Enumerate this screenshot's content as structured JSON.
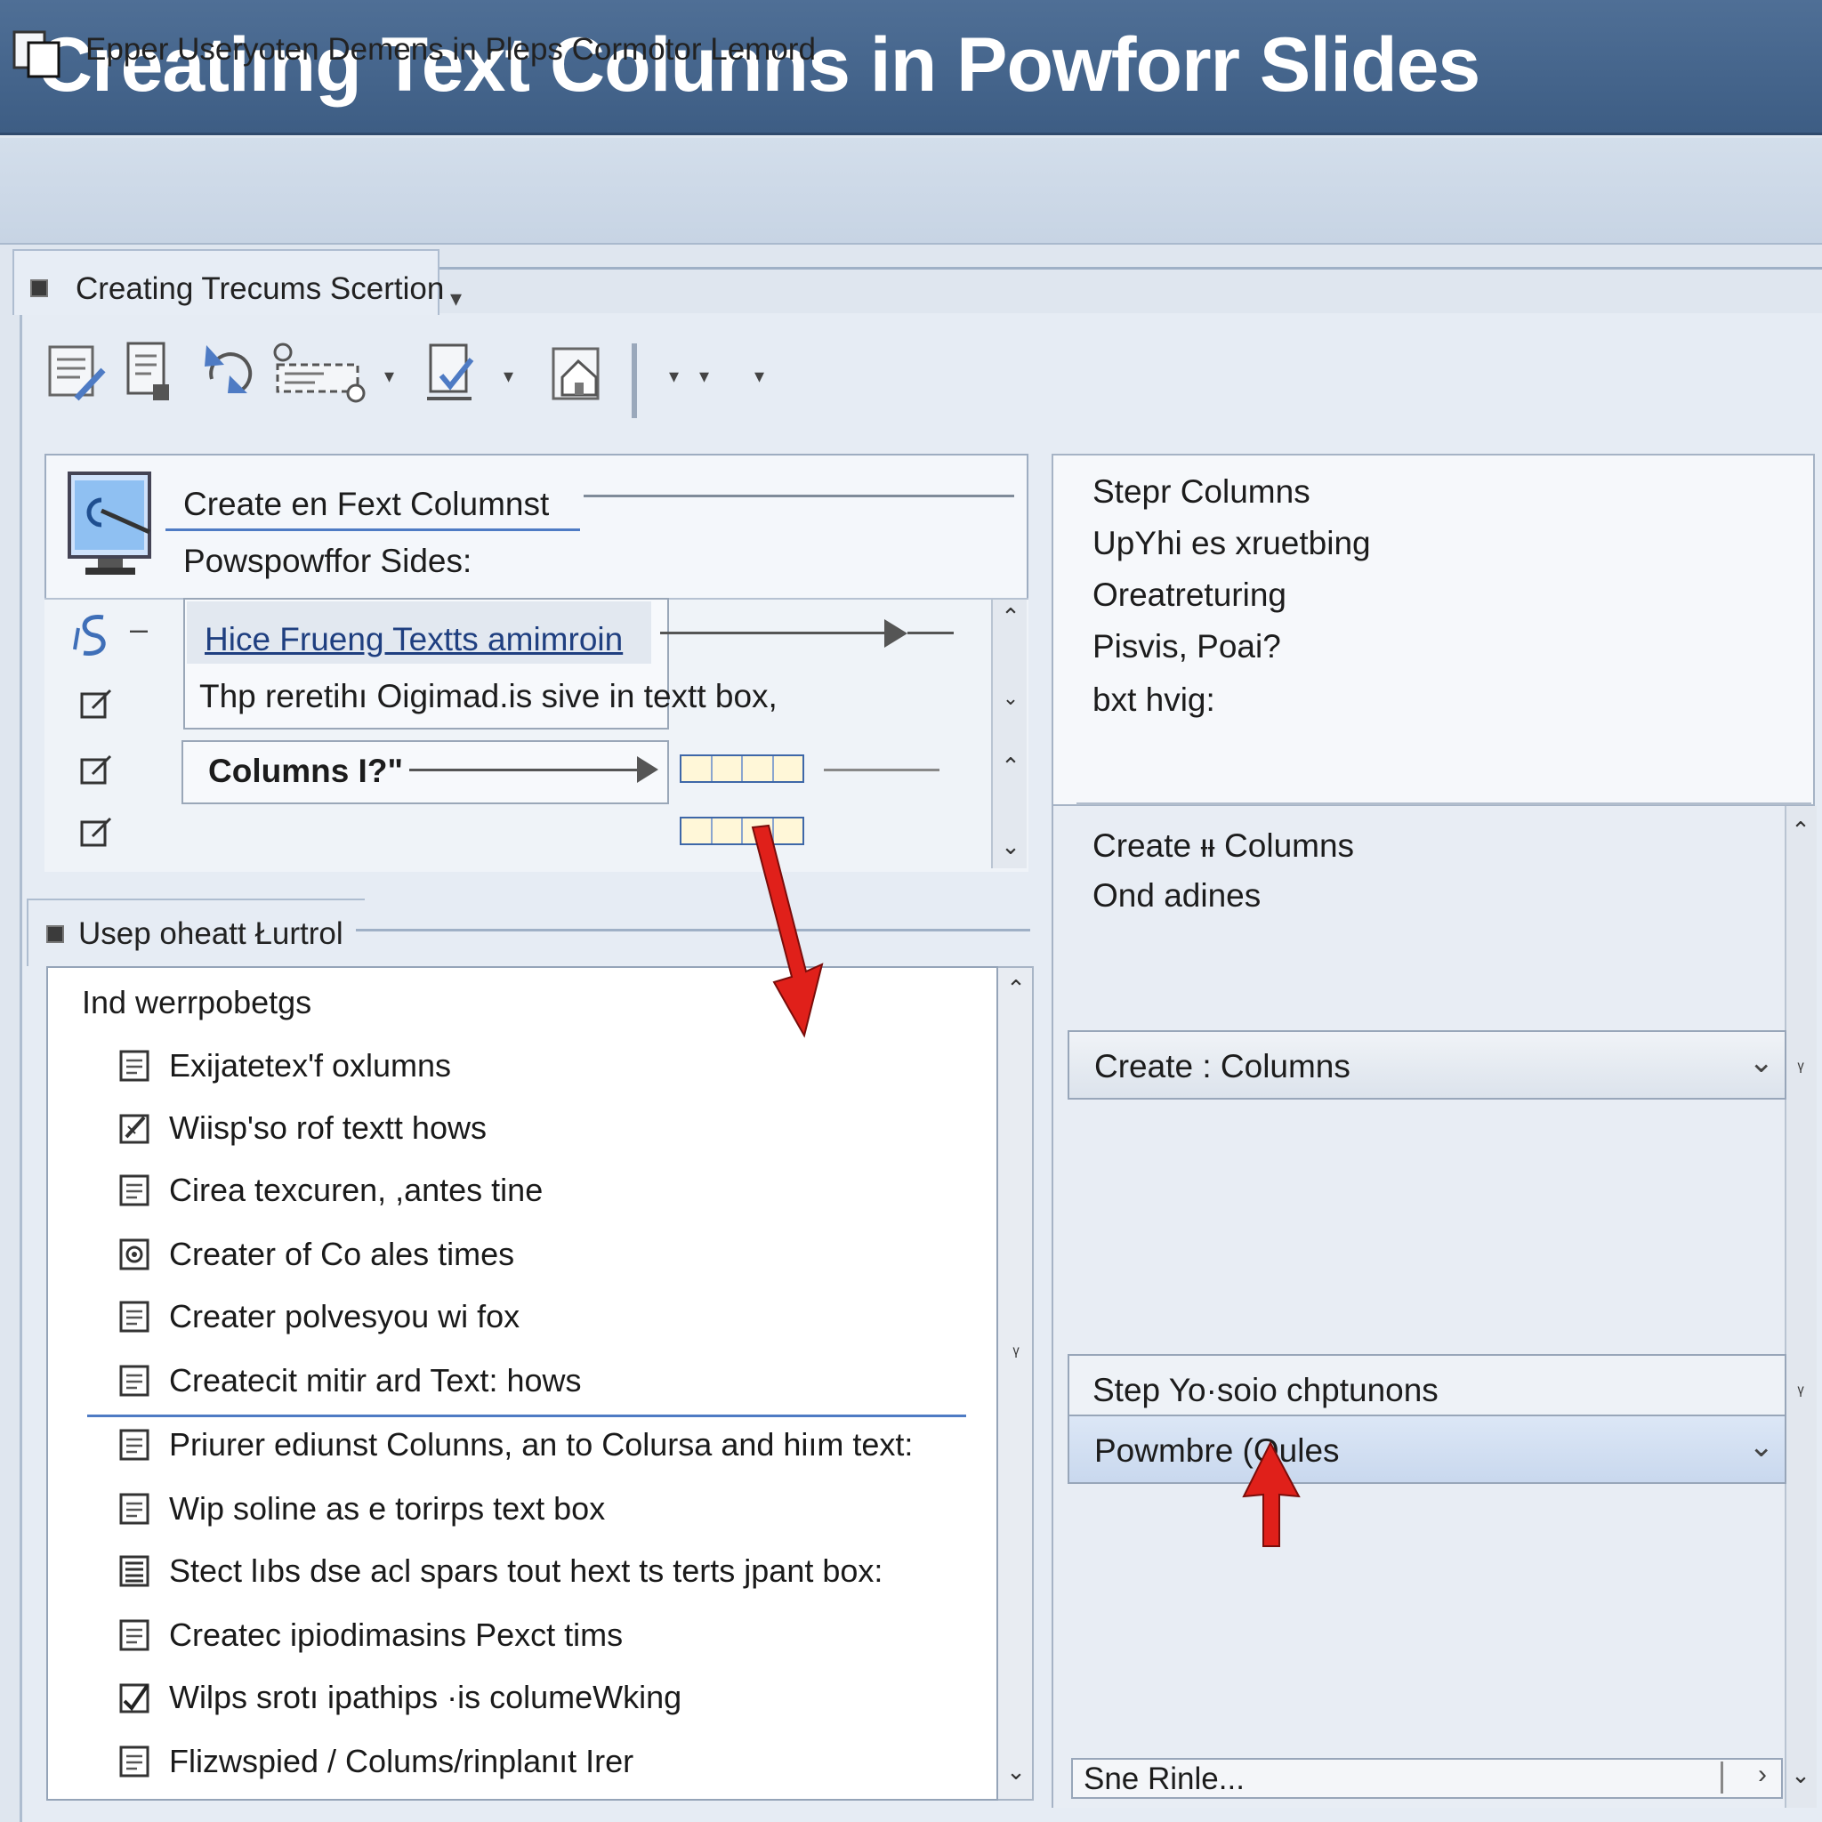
{
  "banner": {
    "title": "Creatiıng Text Colunns in Powforr Slides"
  },
  "appbar": {
    "subtitle": "Epper Useryoten Demens in Pleps Cormotor Lemord"
  },
  "section": {
    "title": "Creating Trecums Scertion"
  },
  "toolbar": {
    "icons": [
      "notes-edit-icon",
      "document-icon",
      "refresh-icon",
      "list-settings-icon",
      "document-check-icon",
      "home-document-icon"
    ],
    "carets": [
      "▾",
      "▾",
      "▾",
      "▾",
      "▾"
    ]
  },
  "create_panel": {
    "title": "Create en Fext Columnst",
    "subtitle": "Powspowffor Sides:",
    "side_dash": "–"
  },
  "hint": {
    "link": "Hice Frueng Textts amimroin",
    "body": "Thp reretihı Oigimad.is sive in  textt box,"
  },
  "columns_field": {
    "label": "Columns I?\""
  },
  "lower_section": {
    "title": "Usep oheatt Łurtrol"
  },
  "list": {
    "heading": "Ind  werrpobetgs",
    "items": [
      {
        "label": "Exijatetex'f oxlumns",
        "icon": "document-icon"
      },
      {
        "label": "Wiisp'so rof textt hows",
        "icon": "edit-icon"
      },
      {
        "label": "Cirea texcuren, ,antes tine",
        "icon": "document-icon"
      },
      {
        "label": "Creater of Co ales times",
        "icon": "settings-icon"
      },
      {
        "label": "Creater polvesyou  wi fox",
        "icon": "document-icon"
      },
      {
        "label": "Createcit mitir ard Text: hows",
        "icon": "document-icon"
      },
      {
        "label": "Priurer ediunst Colunns,  an to Colursa and hiım text:",
        "icon": "document-icon"
      },
      {
        "label": "Wip soline as e torirps text box",
        "icon": "document-icon"
      },
      {
        "label": "Stect lıbs dse acl spars tout hext ts terts jpant  box:",
        "icon": "list-icon"
      },
      {
        "label": "Createc ipiodimasins Pexct tims",
        "icon": "document-icon"
      },
      {
        "label": "Wilps srotı ipathips ·is columeWking",
        "icon": "checkbox-icon"
      },
      {
        "label": "Flizwspied / Colums/rinplanıt Irer",
        "icon": "document-icon"
      }
    ]
  },
  "right_top": {
    "lines": [
      "Stepr Columns",
      "UpYhi es xruetbing",
      "Oreatreturing",
      "Pisvis, Poai?",
      "bxt hvig:"
    ]
  },
  "right_mid": {
    "lines": [
      "Create ᵻᵼ Columns",
      "Ond adines"
    ]
  },
  "dropdowns": {
    "create_columns": "Create :  Columns",
    "step_label": "Step Yo·soio chptunons",
    "powmbre": "Powmbre  (Oules"
  },
  "bottom_bar": {
    "label": "Sne Rinle..."
  },
  "scroll": {
    "up": "⌃",
    "down": "⌄",
    "mark": "ᵞ"
  },
  "colors": {
    "banner": "#3d5d84",
    "accent_line": "#4e7bc4",
    "arrow_red": "#e0201a"
  }
}
